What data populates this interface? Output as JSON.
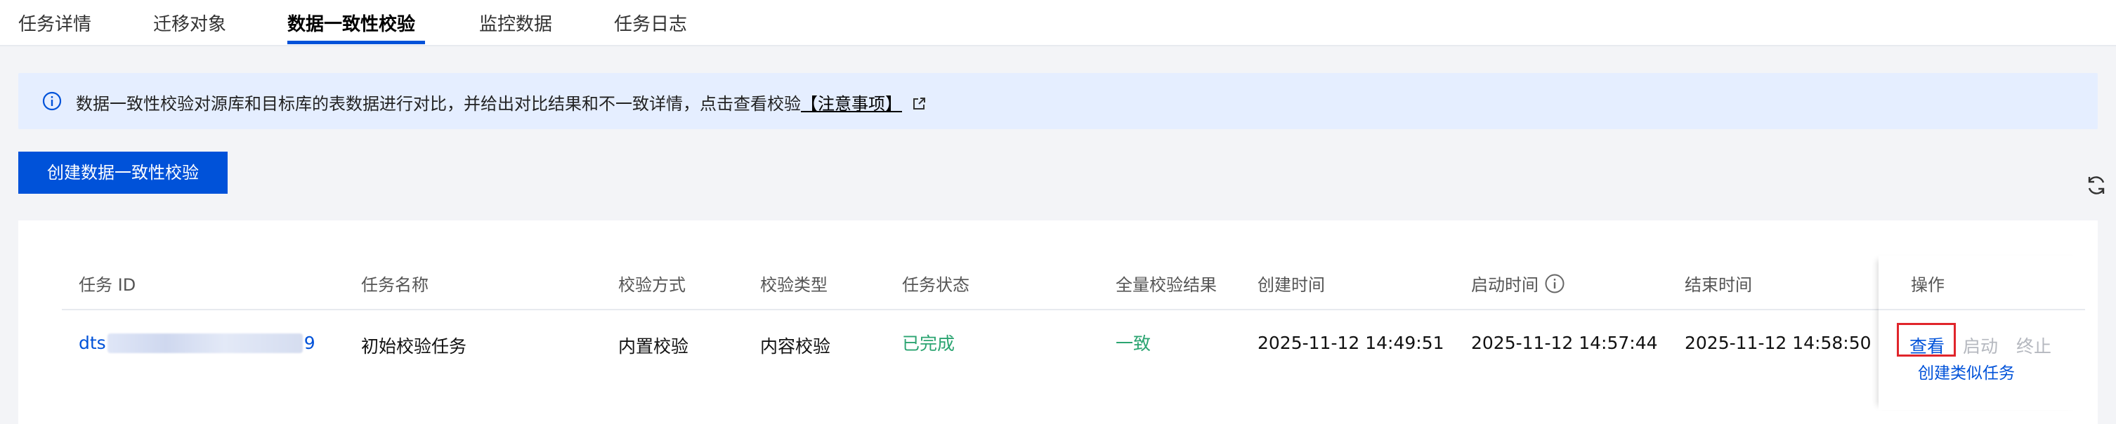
{
  "tabs": [
    {
      "label": "任务详情"
    },
    {
      "label": "迁移对象"
    },
    {
      "label": "数据一致性校验",
      "active": true
    },
    {
      "label": "监控数据"
    },
    {
      "label": "任务日志"
    }
  ],
  "notice": {
    "text": "数据一致性校验对源库和目标库的表数据进行对比，并给出对比结果和不一致详情，点击查看校验",
    "link": "【注意事项】"
  },
  "create_button": "创建数据一致性校验",
  "table": {
    "columns": [
      "任务 ID",
      "任务名称",
      "校验方式",
      "校验类型",
      "任务状态",
      "全量校验结果",
      "创建时间",
      "启动时间",
      "结束时间",
      "操作"
    ],
    "rows": [
      {
        "id_prefix": "dts",
        "id_suffix": "9",
        "name": "初始校验任务",
        "method": "内置校验",
        "type": "内容校验",
        "status": "已完成",
        "result": "一致",
        "created": "2025-11-12 14:49:51",
        "started": "2025-11-12 14:57:44",
        "ended": "2025-11-12 14:58:50",
        "actions": {
          "view": "查看",
          "start": "启动",
          "stop": "终止",
          "clone": "创建类似任务"
        }
      }
    ]
  },
  "colors": {
    "primary": "#0052d9",
    "success": "#2ba471",
    "highlight": "#e0252b"
  }
}
